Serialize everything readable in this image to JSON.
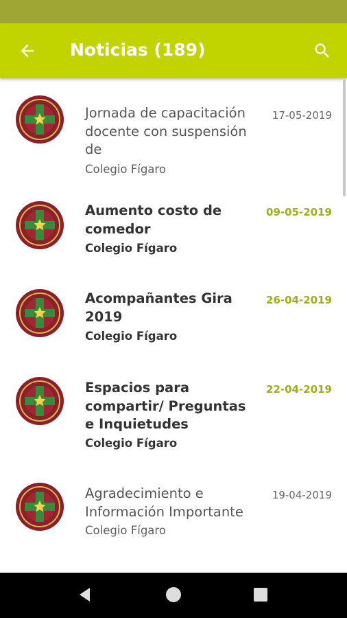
{
  "app_bar": {
    "title": "Noticias (189)",
    "back_icon": "arrow-left-icon",
    "search_icon": "search-icon",
    "background": "#c2d400"
  },
  "news": [
    {
      "title": "Jornada de capacitación docente con suspensión de",
      "source": "Colegio Fígaro",
      "date": "17-05-2019",
      "unread": false
    },
    {
      "title": "Aumento costo de comedor",
      "source": "Colegio Fígaro",
      "date": "09-05-2019",
      "unread": true
    },
    {
      "title": "Acompañantes Gira 2019",
      "source": "Colegio Fígaro",
      "date": "26-04-2019",
      "unread": true
    },
    {
      "title": "Espacios para compartir/ Preguntas e Inquietudes",
      "source": "Colegio Fígaro",
      "date": "22-04-2019",
      "unread": true
    },
    {
      "title": "Agradecimiento e Información Importante",
      "source": "Colegio Fígaro",
      "date": "19-04-2019",
      "unread": false
    }
  ],
  "colors": {
    "accent": "#c2d400",
    "status_bar": "#9fa634",
    "unread_date": "#9fb015"
  },
  "nav_bar": {
    "back_icon": "triangle-back-icon",
    "home_icon": "circle-home-icon",
    "recent_icon": "square-recent-apps-icon"
  }
}
